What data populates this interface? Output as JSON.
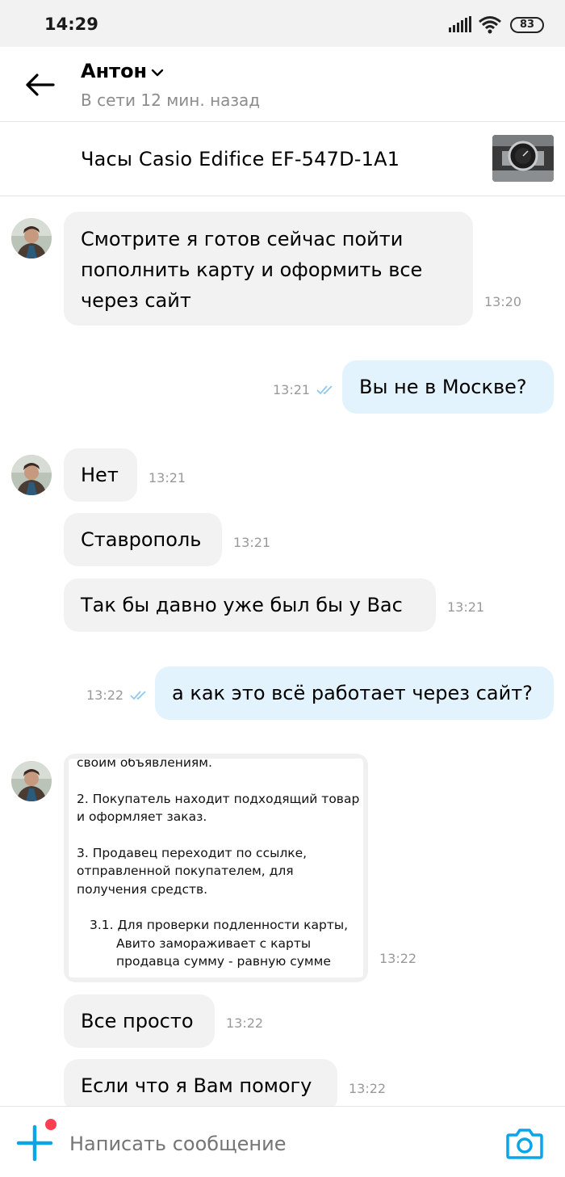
{
  "status_bar": {
    "time": "14:29",
    "battery": "83"
  },
  "header": {
    "name": "Антон",
    "status": "В сети 12 мин. назад"
  },
  "item": {
    "title": "Часы Casio Edifice EF-547D-1A1"
  },
  "messages": [
    {
      "direction": "in",
      "lines": [
        "Смотрите я готов сейчас пойти",
        "пополнить карту и оформить все",
        "через сайт"
      ],
      "time": "13:20"
    },
    {
      "direction": "out",
      "text": "Вы не в Москве?",
      "time": "13:21",
      "status": "read"
    },
    {
      "direction": "in",
      "text": "Нет",
      "time": "13:21"
    },
    {
      "direction": "in",
      "text": "Ставрополь",
      "time": "13:21"
    },
    {
      "direction": "in",
      "text": "Так бы давно уже был бы у Вас",
      "time": "13:21"
    },
    {
      "direction": "out",
      "text": "а как это всё работает через сайт?",
      "time": "13:22",
      "status": "read"
    },
    {
      "direction": "in",
      "type": "image",
      "time": "13:22",
      "image_text": [
        "своим объявлениям.",
        "2. Покупатель находит подходящий товар",
        "и оформляет заказ.",
        "3. Продавец переходит по ссылке,",
        "отправленной покупателем, для",
        "получения средств.",
        "3.1. Для проверки подленности карты,",
        "Авито замораживает с карты",
        "продавца сумму - равную сумме"
      ]
    },
    {
      "direction": "in",
      "text": "Все просто",
      "time": "13:22"
    },
    {
      "direction": "in",
      "text": "Если что я Вам помогу",
      "time": "13:22"
    }
  ],
  "input": {
    "placeholder": "Написать сообщение"
  },
  "colors": {
    "accent": "#0aa5e8",
    "incoming_bubble": "#f2f2f2",
    "outgoing_bubble": "#e3f3fd",
    "notification_dot": "#ff4053"
  }
}
